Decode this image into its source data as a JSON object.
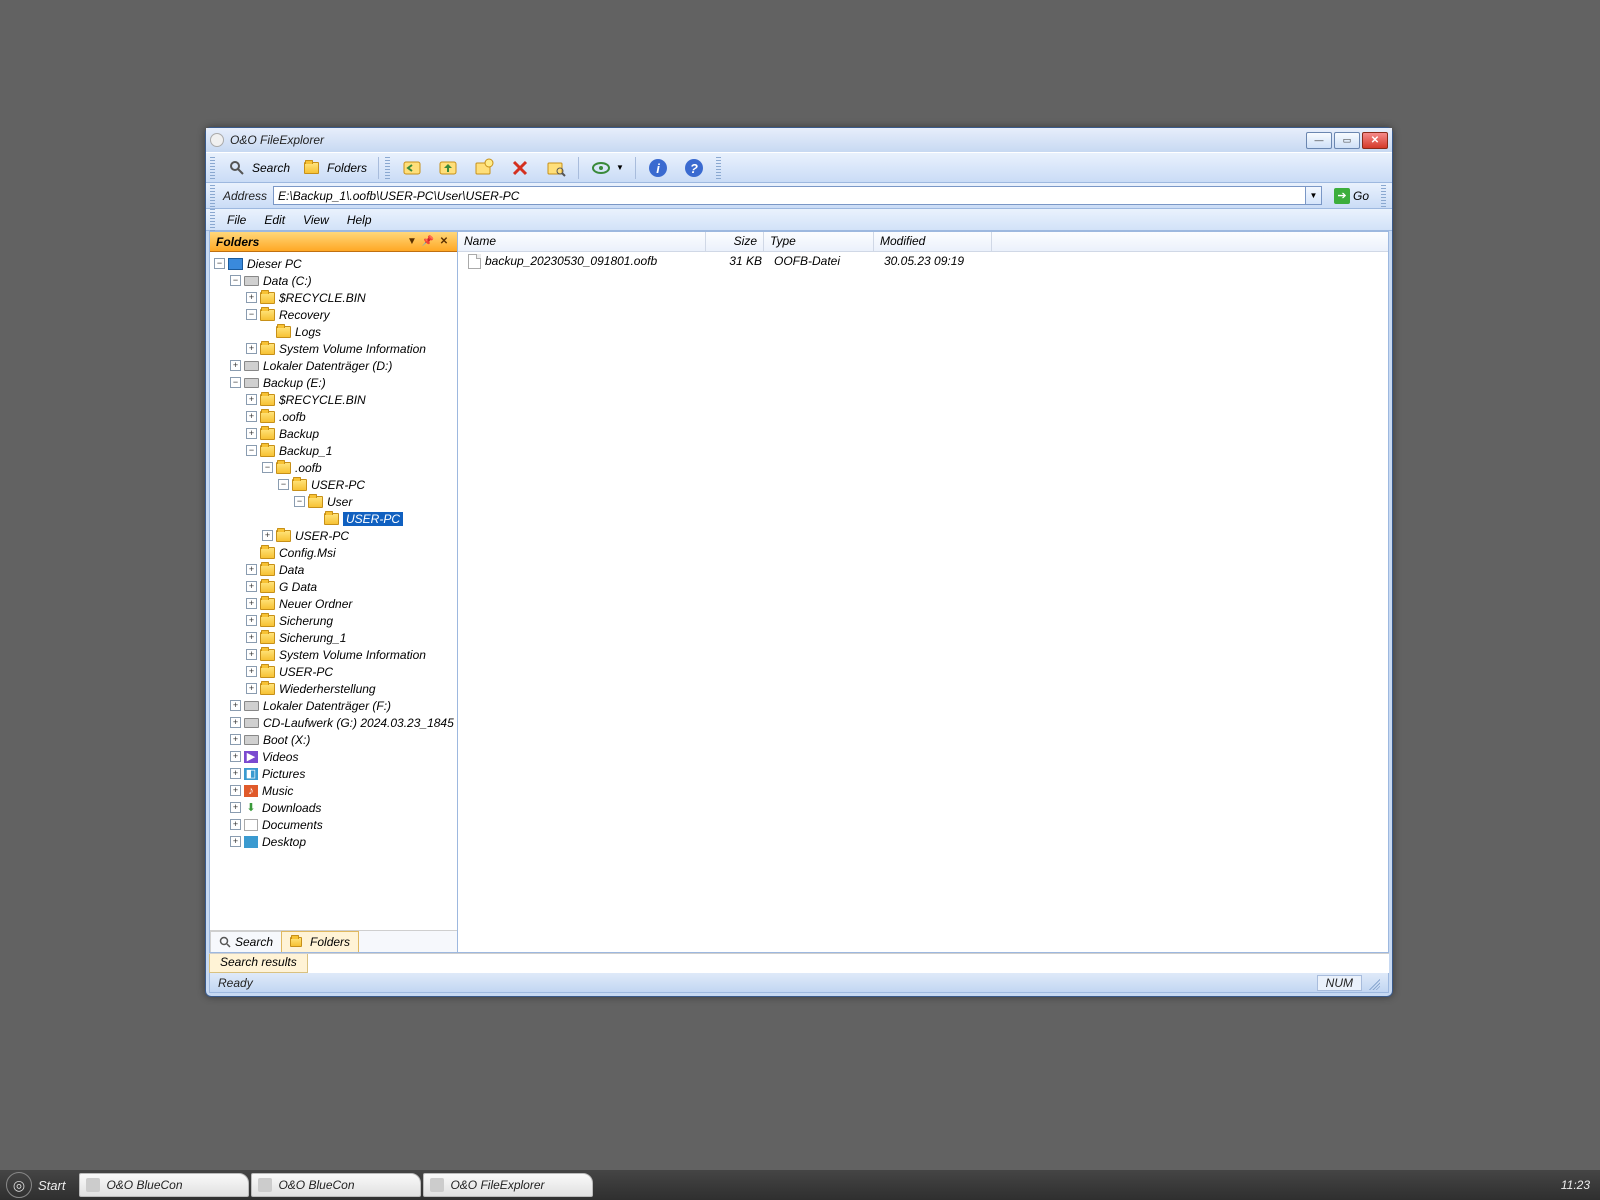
{
  "window": {
    "title": "O&O FileExplorer"
  },
  "toolbar": {
    "search": "Search",
    "folders": "Folders"
  },
  "address": {
    "label": "Address",
    "value": "E:\\Backup_1\\.oofb\\USER-PC\\User\\USER-PC",
    "go": "Go"
  },
  "menus": {
    "file": "File",
    "edit": "Edit",
    "view": "View",
    "help": "Help"
  },
  "panel": {
    "title": "Folders"
  },
  "tree": {
    "root": "Dieser PC",
    "data_c": "Data (C:)",
    "recycle1": "$RECYCLE.BIN",
    "recovery": "Recovery",
    "logs": "Logs",
    "svi1": "System Volume Information",
    "local_d": "Lokaler Datenträger (D:)",
    "backup_e": "Backup (E:)",
    "recycle2": "$RECYCLE.BIN",
    "oofb1": ".oofb",
    "backup": "Backup",
    "backup_1": "Backup_1",
    "oofb2": ".oofb",
    "userpc1": "USER-PC",
    "user": "User",
    "userpc_sel": "USER-PC",
    "userpc2": "USER-PC",
    "configmsi": "Config.Msi",
    "data": "Data",
    "gdata": "G Data",
    "neuer": "Neuer Ordner",
    "sicherung": "Sicherung",
    "sicherung1": "Sicherung_1",
    "svi2": "System Volume Information",
    "userpc3": "USER-PC",
    "wieder": "Wiederherstellung",
    "local_f": "Lokaler Datenträger (F:)",
    "cd_g": "CD-Laufwerk (G:) 2024.03.23_1845",
    "boot_x": "Boot (X:)",
    "videos": "Videos",
    "pictures": "Pictures",
    "music": "Music",
    "downloads": "Downloads",
    "documents": "Documents",
    "desktop": "Desktop"
  },
  "side_tabs": {
    "search": "Search",
    "folders": "Folders"
  },
  "list": {
    "cols": {
      "name": "Name",
      "size": "Size",
      "type": "Type",
      "modified": "Modified"
    },
    "rows": [
      {
        "name": "backup_20230530_091801.oofb",
        "size": "31 KB",
        "type": "OOFB-Datei",
        "modified": "30.05.23 09:19"
      }
    ]
  },
  "bottom_tab": "Search results",
  "status": {
    "ready": "Ready",
    "num": "NUM"
  },
  "taskbar": {
    "start": "Start",
    "items": [
      "O&O BlueCon",
      "O&O BlueCon",
      "O&O FileExplorer"
    ],
    "clock": "11:23"
  }
}
